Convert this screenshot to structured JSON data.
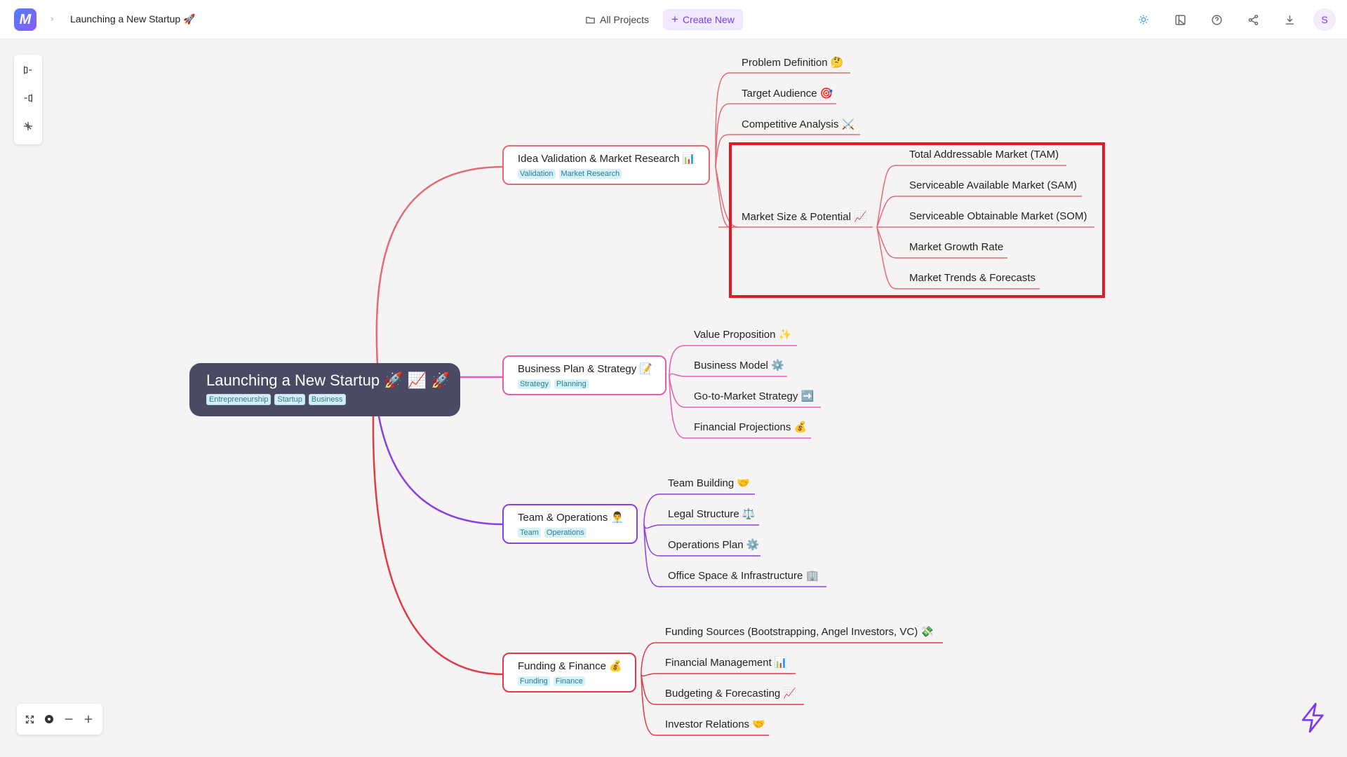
{
  "topbar": {
    "logo_letter": "M",
    "breadcrumb_title": "Launching a New Startup 🚀",
    "all_projects": "All Projects",
    "create_new": "Create New",
    "avatar_initial": "S",
    "icons": [
      "theme-icon",
      "layout-icon",
      "help-icon",
      "share-icon",
      "download-icon"
    ]
  },
  "left_toolbar": {
    "icons": [
      "layout-right-icon",
      "layout-left-icon",
      "layout-radial-icon"
    ]
  },
  "zoom_controls": {
    "icons": [
      "fit-screen-icon",
      "center-icon",
      "zoom-out-icon",
      "zoom-in-icon"
    ]
  },
  "colors": {
    "idea": "#e06c75",
    "business": "#e060b0",
    "team": "#8a3fe0",
    "finance": "#e03a48",
    "root_bg": "#4a4a64",
    "accent": "#7c3aed",
    "highlight": "#e01b24"
  },
  "mindmap": {
    "root": {
      "title": "Launching a New Startup 🚀 📈 🚀",
      "tags": [
        "Entrepreneurship",
        "Startup",
        "Business"
      ]
    },
    "branches": [
      {
        "title": "Idea Validation & Market Research 📊",
        "tags": [
          "Validation",
          "Market Research"
        ],
        "children": [
          "Problem Definition 🤔",
          "Target Audience 🎯",
          "Competitive Analysis ⚔️",
          "Market Size & Potential 📈"
        ],
        "grandchildren": [
          "Total Addressable Market (TAM)",
          "Serviceable Available Market (SAM)",
          "Serviceable Obtainable Market (SOM)",
          "Market Growth Rate",
          "Market Trends & Forecasts"
        ]
      },
      {
        "title": "Business Plan & Strategy 📝",
        "tags": [
          "Strategy",
          "Planning"
        ],
        "children": [
          "Value Proposition ✨",
          "Business Model ⚙️",
          "Go-to-Market Strategy ➡️",
          "Financial Projections 💰"
        ]
      },
      {
        "title": "Team & Operations 👨‍💼",
        "tags": [
          "Team",
          "Operations"
        ],
        "children": [
          "Team Building 🤝",
          "Legal Structure ⚖️",
          "Operations Plan ⚙️",
          "Office Space & Infrastructure 🏢"
        ]
      },
      {
        "title": "Funding & Finance 💰",
        "tags": [
          "Funding",
          "Finance"
        ],
        "children": [
          "Funding Sources (Bootstrapping, Angel Investors, VC) 💸",
          "Financial Management 📊",
          "Budgeting & Forecasting 📈",
          "Investor Relations 🤝"
        ]
      }
    ]
  }
}
